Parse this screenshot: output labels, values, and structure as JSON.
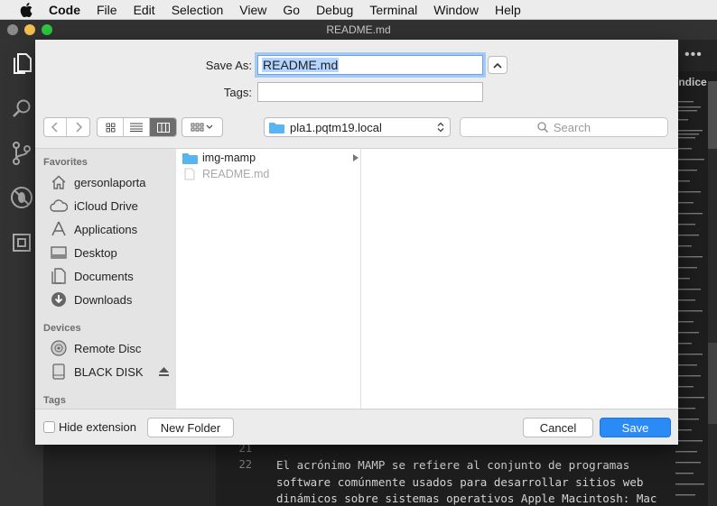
{
  "menubar": {
    "app": "Code",
    "items": [
      "File",
      "Edit",
      "Selection",
      "View",
      "Go",
      "Debug",
      "Terminal",
      "Window",
      "Help"
    ]
  },
  "window": {
    "title": "README.md",
    "outline_heading": "índice",
    "more": "•••"
  },
  "activity_icons": [
    "files-icon",
    "search-icon",
    "source-control-icon",
    "debug-icon",
    "extensions-icon"
  ],
  "editor": {
    "lines": [
      {
        "num": "21",
        "text": ""
      },
      {
        "num": "22",
        "text": "El acrónimo MAMP se refiere al conjunto de programas"
      },
      {
        "num": "",
        "text": "software comúnmente usados para desarrollar sitios web"
      },
      {
        "num": "",
        "text": "dinámicos sobre sistemas operativos Apple Macintosh: Mac"
      }
    ]
  },
  "dialog": {
    "save_as_label": "Save As:",
    "save_as_value": "README.md",
    "tags_label": "Tags:",
    "tags_value": "",
    "location": "pla1.pqtm19.local",
    "search_placeholder": "Search",
    "sections": {
      "favorites": "Favorites",
      "devices": "Devices",
      "tags": "Tags"
    },
    "favorites": [
      {
        "label": "gersonlaporta",
        "icon": "home-icon"
      },
      {
        "label": "iCloud Drive",
        "icon": "cloud-icon"
      },
      {
        "label": "Applications",
        "icon": "applications-icon"
      },
      {
        "label": "Desktop",
        "icon": "desktop-icon"
      },
      {
        "label": "Documents",
        "icon": "documents-icon"
      },
      {
        "label": "Downloads",
        "icon": "downloads-icon"
      }
    ],
    "devices": [
      {
        "label": "Remote Disc",
        "icon": "disc-icon"
      },
      {
        "label": "BLACK DISK",
        "icon": "disk-icon"
      }
    ],
    "files": [
      {
        "name": "img-mamp",
        "type": "folder"
      },
      {
        "name": "README.md",
        "type": "file"
      }
    ],
    "hide_extension_label": "Hide extension",
    "new_folder_label": "New Folder",
    "cancel_label": "Cancel",
    "save_label": "Save"
  },
  "colors": {
    "accent": "#2a8af6",
    "folder": "#5ab4f0",
    "editor_bg": "#1e1e1e"
  }
}
